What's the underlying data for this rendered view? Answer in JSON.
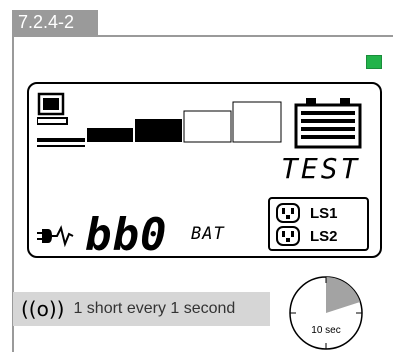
{
  "section": {
    "label": "7.2.4-2"
  },
  "lcd": {
    "mode_text": "TEST",
    "readout_value": "bb0",
    "readout_unit": "BAT",
    "load_segments": 5,
    "filled_segments": 3,
    "outlets": [
      {
        "label": "LS1"
      },
      {
        "label": "LS2"
      }
    ]
  },
  "indicator": {
    "color": "#22b34a"
  },
  "beep_note": {
    "icon": "((o))",
    "text": "1 short every 1 second"
  },
  "timer": {
    "label": "10 sec"
  }
}
